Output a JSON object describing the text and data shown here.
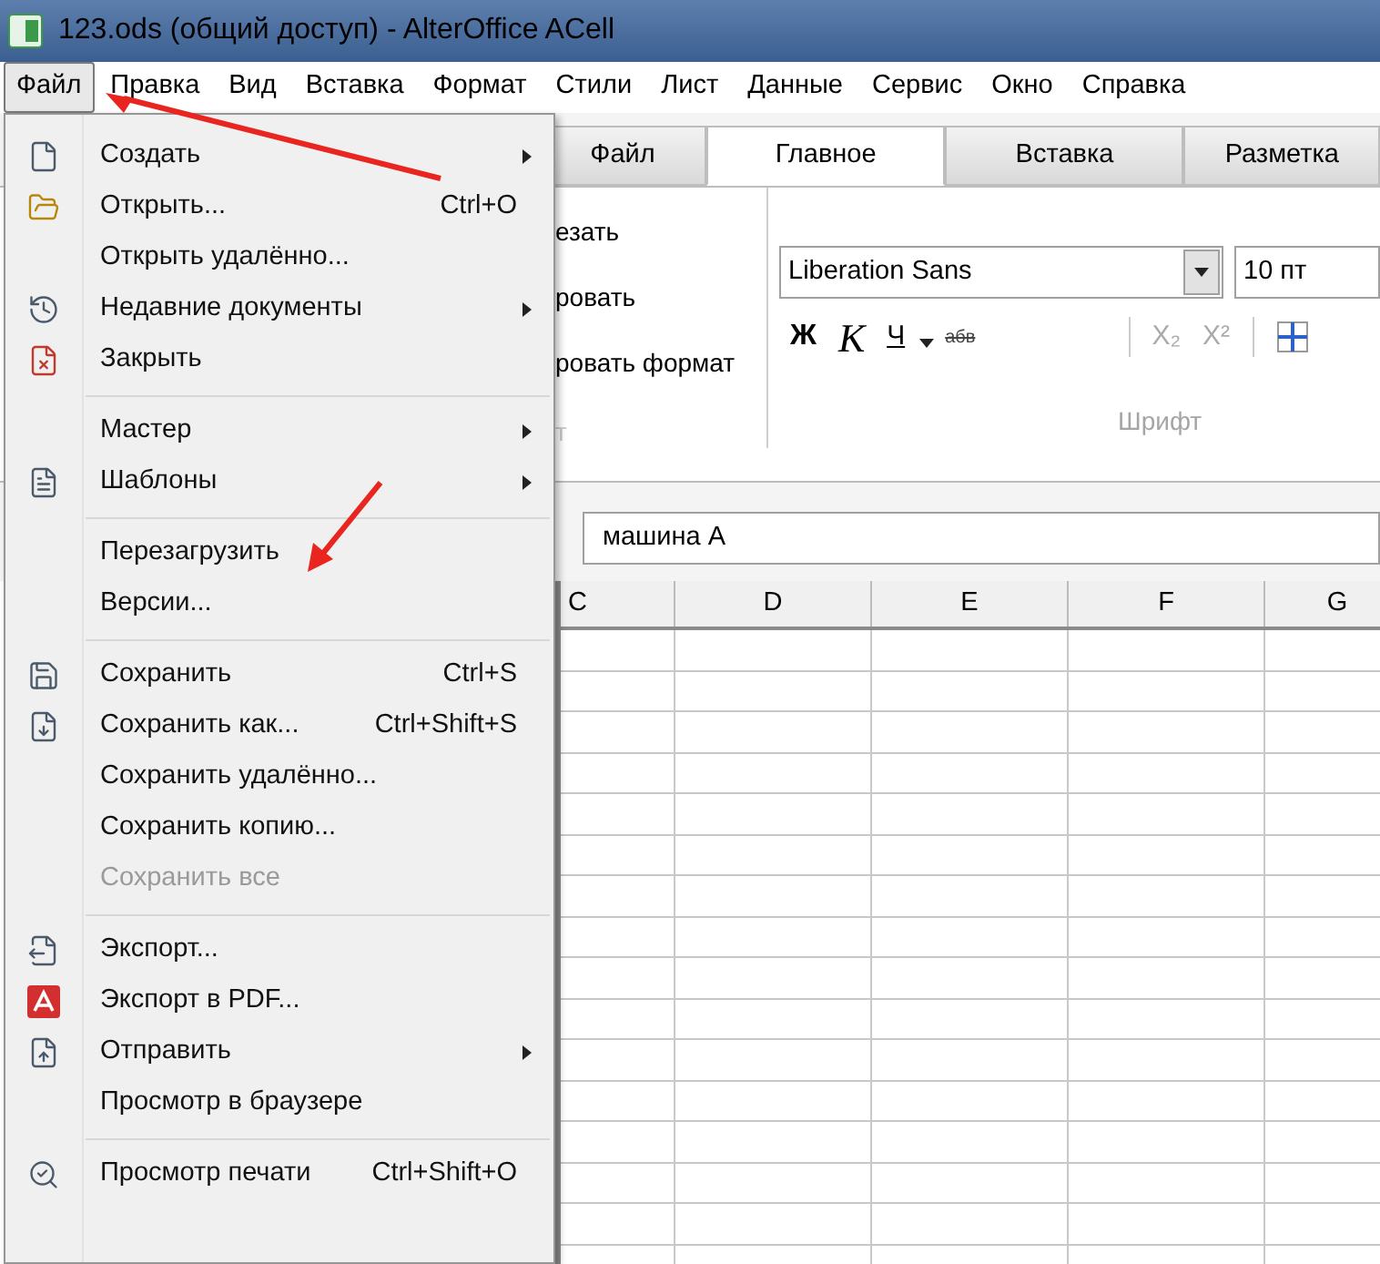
{
  "window": {
    "title": "123.ods (общий доступ) - AlterOffice ACell"
  },
  "menu_bar": [
    {
      "label": "Файл",
      "selected": true
    },
    {
      "label": "Правка",
      "selected": false
    },
    {
      "label": "Вид",
      "selected": false
    },
    {
      "label": "Вставка",
      "selected": false
    },
    {
      "label": "Формат",
      "selected": false
    },
    {
      "label": "Стили",
      "selected": false
    },
    {
      "label": "Лист",
      "selected": false
    },
    {
      "label": "Данные",
      "selected": false
    },
    {
      "label": "Сервис",
      "selected": false
    },
    {
      "label": "Окно",
      "selected": false
    },
    {
      "label": "Справка",
      "selected": false
    }
  ],
  "file_menu": [
    [
      {
        "label": "Создать",
        "submenu": true,
        "disabled": false
      },
      {
        "label": "Открыть...",
        "shortcut": "Ctrl+O",
        "submenu": false,
        "disabled": false
      },
      {
        "label": "Открыть удалённо...",
        "submenu": false,
        "disabled": false
      },
      {
        "label": "Недавние документы",
        "submenu": true,
        "disabled": false
      },
      {
        "label": "Закрыть",
        "submenu": false,
        "disabled": false
      }
    ],
    [
      {
        "label": "Мастер",
        "submenu": true,
        "disabled": false
      },
      {
        "label": "Шаблоны",
        "submenu": true,
        "disabled": false
      }
    ],
    [
      {
        "label": "Перезагрузить",
        "submenu": false,
        "disabled": false
      },
      {
        "label": "Версии...",
        "submenu": false,
        "disabled": false
      }
    ],
    [
      {
        "label": "Сохранить",
        "shortcut": "Ctrl+S",
        "submenu": false,
        "disabled": false
      },
      {
        "label": "Сохранить как...",
        "shortcut": "Ctrl+Shift+S",
        "submenu": false,
        "disabled": false
      },
      {
        "label": "Сохранить удалённо...",
        "submenu": false,
        "disabled": false
      },
      {
        "label": "Сохранить копию...",
        "submenu": false,
        "disabled": false
      },
      {
        "label": "Сохранить все",
        "submenu": false,
        "disabled": true
      }
    ],
    [
      {
        "label": "Экспорт...",
        "submenu": false,
        "disabled": false
      },
      {
        "label": "Экспорт в PDF...",
        "submenu": false,
        "disabled": false
      },
      {
        "label": "Отправить",
        "submenu": true,
        "disabled": false
      },
      {
        "label": "Просмотр в браузере",
        "submenu": false,
        "disabled": false
      }
    ],
    [
      {
        "label": "Просмотр печати",
        "shortcut": "Ctrl+Shift+O",
        "submenu": false,
        "disabled": false
      }
    ]
  ],
  "ribbon_tabs": [
    {
      "label": "Файл",
      "selected": false
    },
    {
      "label": "Главное",
      "selected": true
    },
    {
      "label": "Вставка",
      "selected": false
    },
    {
      "label": "Разметка",
      "selected": false
    }
  ],
  "clipboard_group": {
    "items": [
      "езать",
      "ровать",
      "ровать формат"
    ],
    "label": "т"
  },
  "font_group": {
    "font_name": "Liberation Sans",
    "font_size": "10 пт",
    "bold": "Ж",
    "italic": "К",
    "underline": "Ч",
    "strikethrough": "абв",
    "subscript": "X₂",
    "superscript": "X²",
    "label": "Шрифт"
  },
  "formula_bar": {
    "value": "машина А"
  },
  "columns": [
    "C",
    "D",
    "E",
    "F",
    "G"
  ]
}
